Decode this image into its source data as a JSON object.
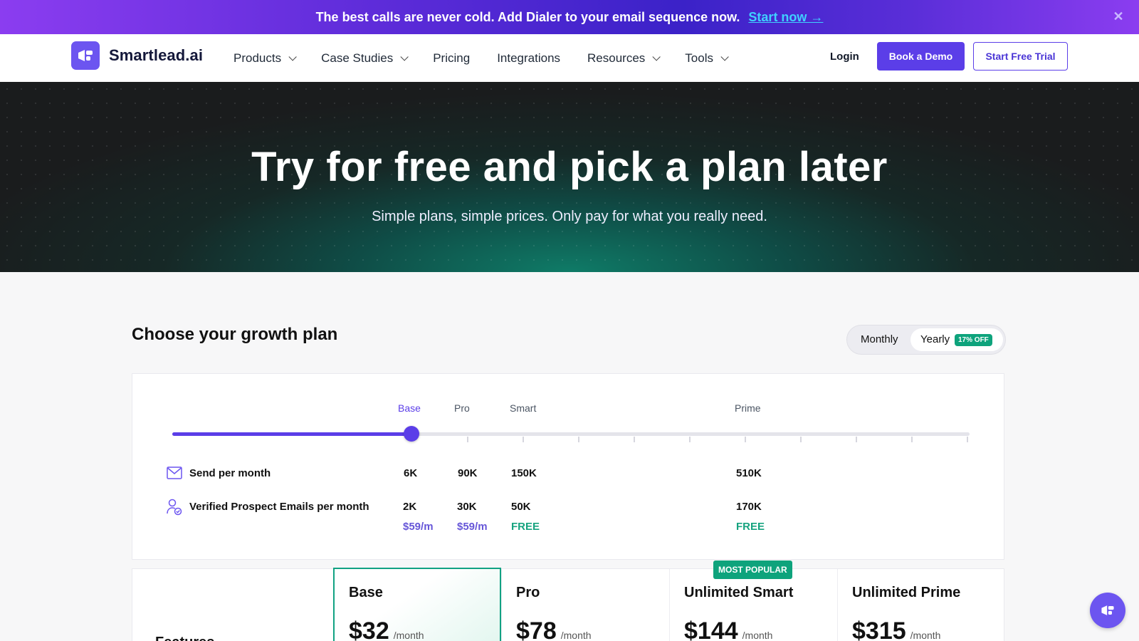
{
  "announcement": {
    "text": "The best calls are never cold. Add Dialer to your email sequence now.",
    "cta": "Start now →",
    "close_icon": "close-icon"
  },
  "nav": {
    "brand": "Smartlead.ai",
    "items": [
      {
        "label": "Products",
        "dropdown": true
      },
      {
        "label": "Case Studies",
        "dropdown": true
      },
      {
        "label": "Pricing",
        "dropdown": false
      },
      {
        "label": "Integrations",
        "dropdown": false
      },
      {
        "label": "Resources",
        "dropdown": true
      },
      {
        "label": "Tools",
        "dropdown": true
      }
    ],
    "login": "Login",
    "book_demo": "Book a Demo",
    "start_trial": "Start Free Trial"
  },
  "hero": {
    "title": "Try for free and pick a plan later",
    "subtitle": "Simple plans, simple prices. Only pay for what you really need."
  },
  "plans_section": {
    "title": "Choose your growth plan",
    "billing": {
      "monthly": "Monthly",
      "yearly": "Yearly",
      "discount": "17% OFF",
      "selected": "Yearly"
    }
  },
  "slider": {
    "tiers": [
      "Base",
      "Pro",
      "Smart",
      "Prime"
    ],
    "active_tier": "Base",
    "position_fraction": 0.3,
    "rows": [
      {
        "label": "Send per month",
        "icon": "mail-icon",
        "values": [
          "6K",
          "90K",
          "150K",
          "510K"
        ]
      },
      {
        "label": "Verified Prospect Emails per month",
        "icon": "user-check-icon",
        "values": [
          "2K",
          "30K",
          "50K",
          "170K"
        ]
      }
    ],
    "prices": [
      "$59/m",
      "$59/m",
      "FREE",
      "FREE"
    ]
  },
  "plans": {
    "features_label": "Features",
    "popular_badge": "MOST POPULAR",
    "per": "/month",
    "items": [
      {
        "name": "Base",
        "price": "$32"
      },
      {
        "name": "Pro",
        "price": "$78"
      },
      {
        "name": "Unlimited Smart",
        "price": "$144"
      },
      {
        "name": "Unlimited Prime",
        "price": "$315"
      }
    ]
  },
  "colors": {
    "accent": "#5b3ee8",
    "green": "#0ea37c",
    "hero_dark": "#1a1c1d"
  }
}
